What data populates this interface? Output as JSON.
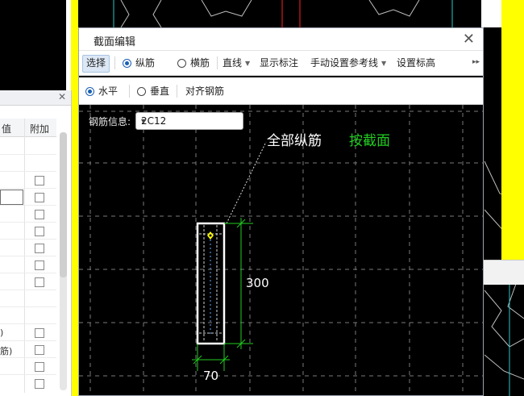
{
  "dialog": {
    "title": "截面编辑",
    "toolbar1": {
      "select": "选择",
      "longitudinal": "纵筋",
      "transverse": "横筋",
      "line": "直线",
      "show_label": "显示标注",
      "manual_ref": "手动设置参考线",
      "set_elevation": "设置标高",
      "more": "▸▸"
    },
    "toolbar2": {
      "horizontal": "水平",
      "vertical": "垂直",
      "align": "对齐钢筋"
    },
    "rebar_info_label": "钢筋信息:",
    "rebar_value": "2C12",
    "canvas": {
      "label_all": "全部纵筋",
      "label_by_section": "按截面",
      "dim_height": "300",
      "dim_width": "70"
    }
  },
  "left_panel": {
    "col_value": "值",
    "col_extra": "附加",
    "side_labels": [
      ")",
      "筋)"
    ]
  },
  "colors": {
    "cad_green": "#22cc22",
    "cad_yellow": "#ffff00",
    "accent_blue": "#1a5fb4"
  },
  "icons": [
    "close-icon",
    "dropdown-caret-icon",
    "radio-icon",
    "checkbox-icon",
    "more-icon"
  ]
}
